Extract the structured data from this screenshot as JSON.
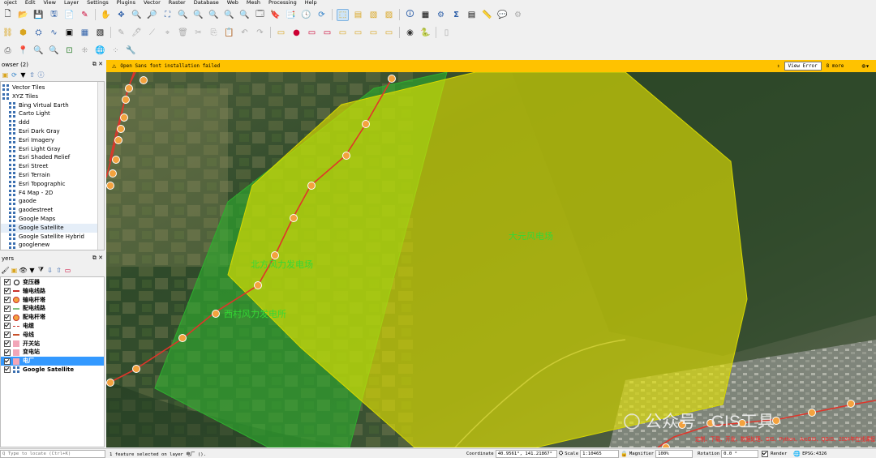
{
  "menu": [
    "oject",
    "Edit",
    "View",
    "Layer",
    "Settings",
    "Plugins",
    "Vector",
    "Raster",
    "Database",
    "Web",
    "Mesh",
    "Processing",
    "Help"
  ],
  "browser": {
    "title": "owser (2)",
    "items": [
      "Vector Tiles",
      "XYZ Tiles",
      "Bing Virtual Earth",
      "Carto Light",
      "ddd",
      "Esri Dark Gray",
      "Esri Imagery",
      "Esri Light Gray",
      "Esri Shaded Relief",
      "Esri Street",
      "Esri Terrain",
      "Esri Topographic",
      "F4 Map - 2D",
      "gaode",
      "gaodestreet",
      "Google Maps",
      "Google Satellite",
      "Google Satellite Hybrid",
      "googlenew"
    ]
  },
  "layers": {
    "title": "yers",
    "items": [
      "变压器",
      "输电线路",
      "输电杆塔",
      "配电线路",
      "配电杆塔",
      "电缆",
      "母线",
      "开关站",
      "变电站",
      "电厂",
      "Google Satellite"
    ]
  },
  "message": {
    "icon": "warning-icon",
    "text": "Open Sans font installation failed",
    "view_error": "View Error",
    "more": "8 more"
  },
  "map": {
    "label_a": "大元风电场",
    "label_b": "北方风力发电场",
    "label_c": "西村风力发电所",
    "watermark": "公众号 · GIS工具",
    "red_text": "定制、下载、开发、数据处理、GIS、Python、ArcGIS、QGIS、2024年在线课程"
  },
  "colors": {
    "yellow_polygon": "#e8e600",
    "green_polygon": "#2fae2f",
    "line": "#e0352a",
    "node_fill": "#f3a23e",
    "message_bar": "#ffc200",
    "selection": "#3399ff"
  },
  "status": {
    "locate_placeholder": "Q Type to locate (Ctrl+K)",
    "message": "1 feature selected on layer 电厂 ().",
    "coord_label": "Coordinate",
    "coord_value": "40.9561°, 141.21867°",
    "scale_label": "Scale",
    "scale_value": "1:10465",
    "magnifier_label": "Magnifier",
    "magnifier_value": "100%",
    "rotation_label": "Rotation",
    "rotation_value": "0.0 °",
    "render_label": "Render",
    "crs": "EPSG:4326"
  }
}
